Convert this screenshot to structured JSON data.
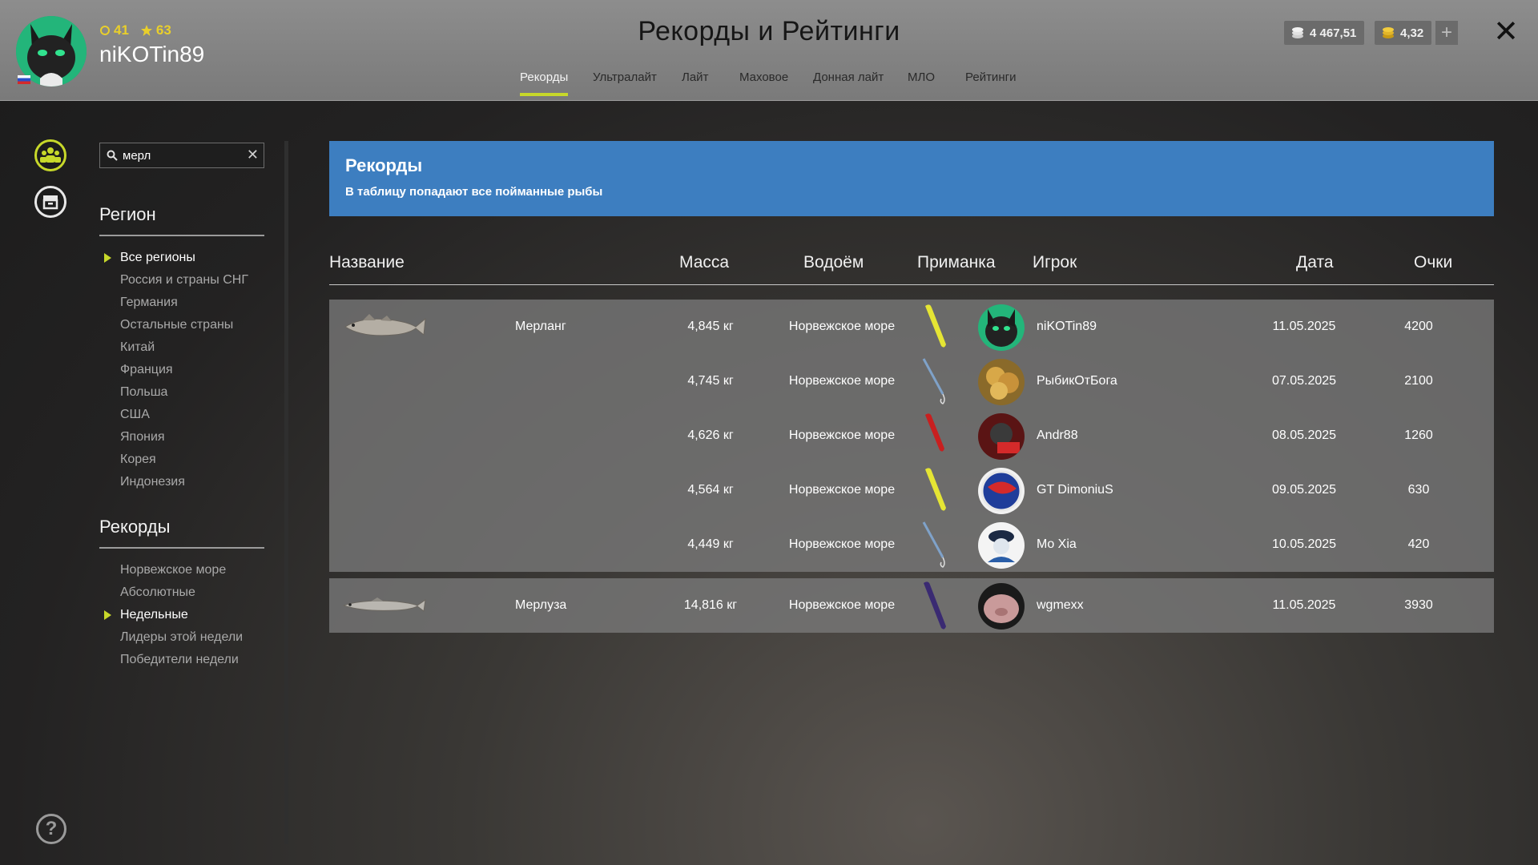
{
  "header": {
    "title": "Рекорды и Рейтинги",
    "username": "niKOTin89",
    "level": "41",
    "rank": "63",
    "silver": "4 467,51",
    "gold": "4,32",
    "plus_label": "+",
    "close_label": "✕",
    "tabs": [
      {
        "label": "Рекорды"
      },
      {
        "label": "Ультралайт"
      },
      {
        "label": "Лайт"
      },
      {
        "label": "Маховое"
      },
      {
        "label": "Донная лайт"
      },
      {
        "label": "МЛО"
      },
      {
        "label": "Рейтинги"
      }
    ]
  },
  "sidebar": {
    "search_value": "мерл",
    "help_label": "?",
    "region_title": "Регион",
    "regions": [
      {
        "label": "Все регионы"
      },
      {
        "label": "Россия и страны СНГ"
      },
      {
        "label": "Германия"
      },
      {
        "label": "Остальные страны"
      },
      {
        "label": "Китай"
      },
      {
        "label": "Франция"
      },
      {
        "label": "Польша"
      },
      {
        "label": "США"
      },
      {
        "label": "Япония"
      },
      {
        "label": "Корея"
      },
      {
        "label": "Индонезия"
      }
    ],
    "records_title": "Рекорды",
    "records": [
      {
        "label": "Норвежское море"
      },
      {
        "label": "Абсолютные"
      },
      {
        "label": "Недельные"
      },
      {
        "label": "Лидеры этой недели"
      },
      {
        "label": "Победители недели"
      }
    ]
  },
  "banner": {
    "title": "Рекорды",
    "subtitle": "В таблицу попадают все пойманные рыбы"
  },
  "table": {
    "columns": {
      "name": "Название",
      "mass": "Масса",
      "water": "Водоём",
      "bait": "Приманка",
      "player": "Игрок",
      "date": "Дата",
      "points": "Очки"
    },
    "groups": [
      {
        "fish": "Мерланг",
        "rows": [
          {
            "mass": "4,845 кг",
            "water": "Норвежское море",
            "player": "niKOTin89",
            "date": "11.05.2025",
            "points": "4200"
          },
          {
            "mass": "4,745 кг",
            "water": "Норвежское море",
            "player": "РыбикОтБога",
            "date": "07.05.2025",
            "points": "2100"
          },
          {
            "mass": "4,626 кг",
            "water": "Норвежское море",
            "player": "Andr88",
            "date": "08.05.2025",
            "points": "1260"
          },
          {
            "mass": "4,564 кг",
            "water": "Норвежское море",
            "player": "GT DimoniuS",
            "date": "09.05.2025",
            "points": "630"
          },
          {
            "mass": "4,449 кг",
            "water": "Норвежское море",
            "player": "Mo Xia",
            "date": "10.05.2025",
            "points": "420"
          }
        ]
      },
      {
        "fish": "Мерлуза",
        "rows": [
          {
            "mass": "14,816 кг",
            "water": "Норвежское море",
            "player": "wgmexx",
            "date": "11.05.2025",
            "points": "3930"
          }
        ]
      }
    ]
  },
  "colors": {
    "accent": "#c7d82a",
    "banner": "#3d7ec0",
    "header": "#858585"
  }
}
